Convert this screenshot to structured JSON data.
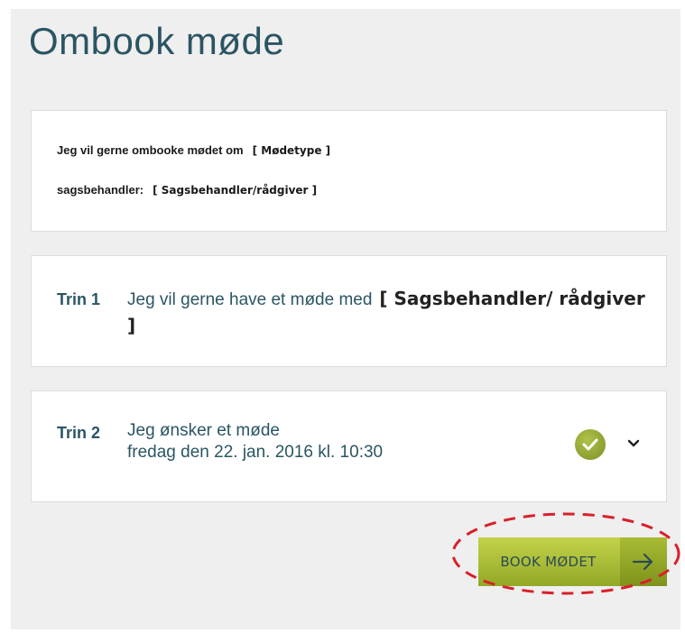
{
  "page": {
    "title": "Ombook møde"
  },
  "info": {
    "line1_text": "Jeg vil gerne ombooke mødet om",
    "line1_placeholder": "[ Mødetype ]",
    "line2_text": "sagsbehandler:",
    "line2_placeholder": "[ Sagsbehandler/rådgiver ]"
  },
  "step1": {
    "label": "Trin 1",
    "text": "Jeg vil gerne have et møde med",
    "placeholder": "[ Sagsbehandler/ rådgiver ]"
  },
  "step2": {
    "label": "Trin 2",
    "text_line1": "Jeg ønsker et møde",
    "text_line2": "fredag den 22. jan. 2016 kl. 10:30",
    "status_icon": "check-circle-icon",
    "expand_icon": "chevron-down-icon"
  },
  "action": {
    "book_label": "BOOK MØDET",
    "arrow_icon": "arrow-right-icon"
  },
  "colors": {
    "accent": "#93a827",
    "text": "#2b5563",
    "highlight": "#d8202a"
  }
}
